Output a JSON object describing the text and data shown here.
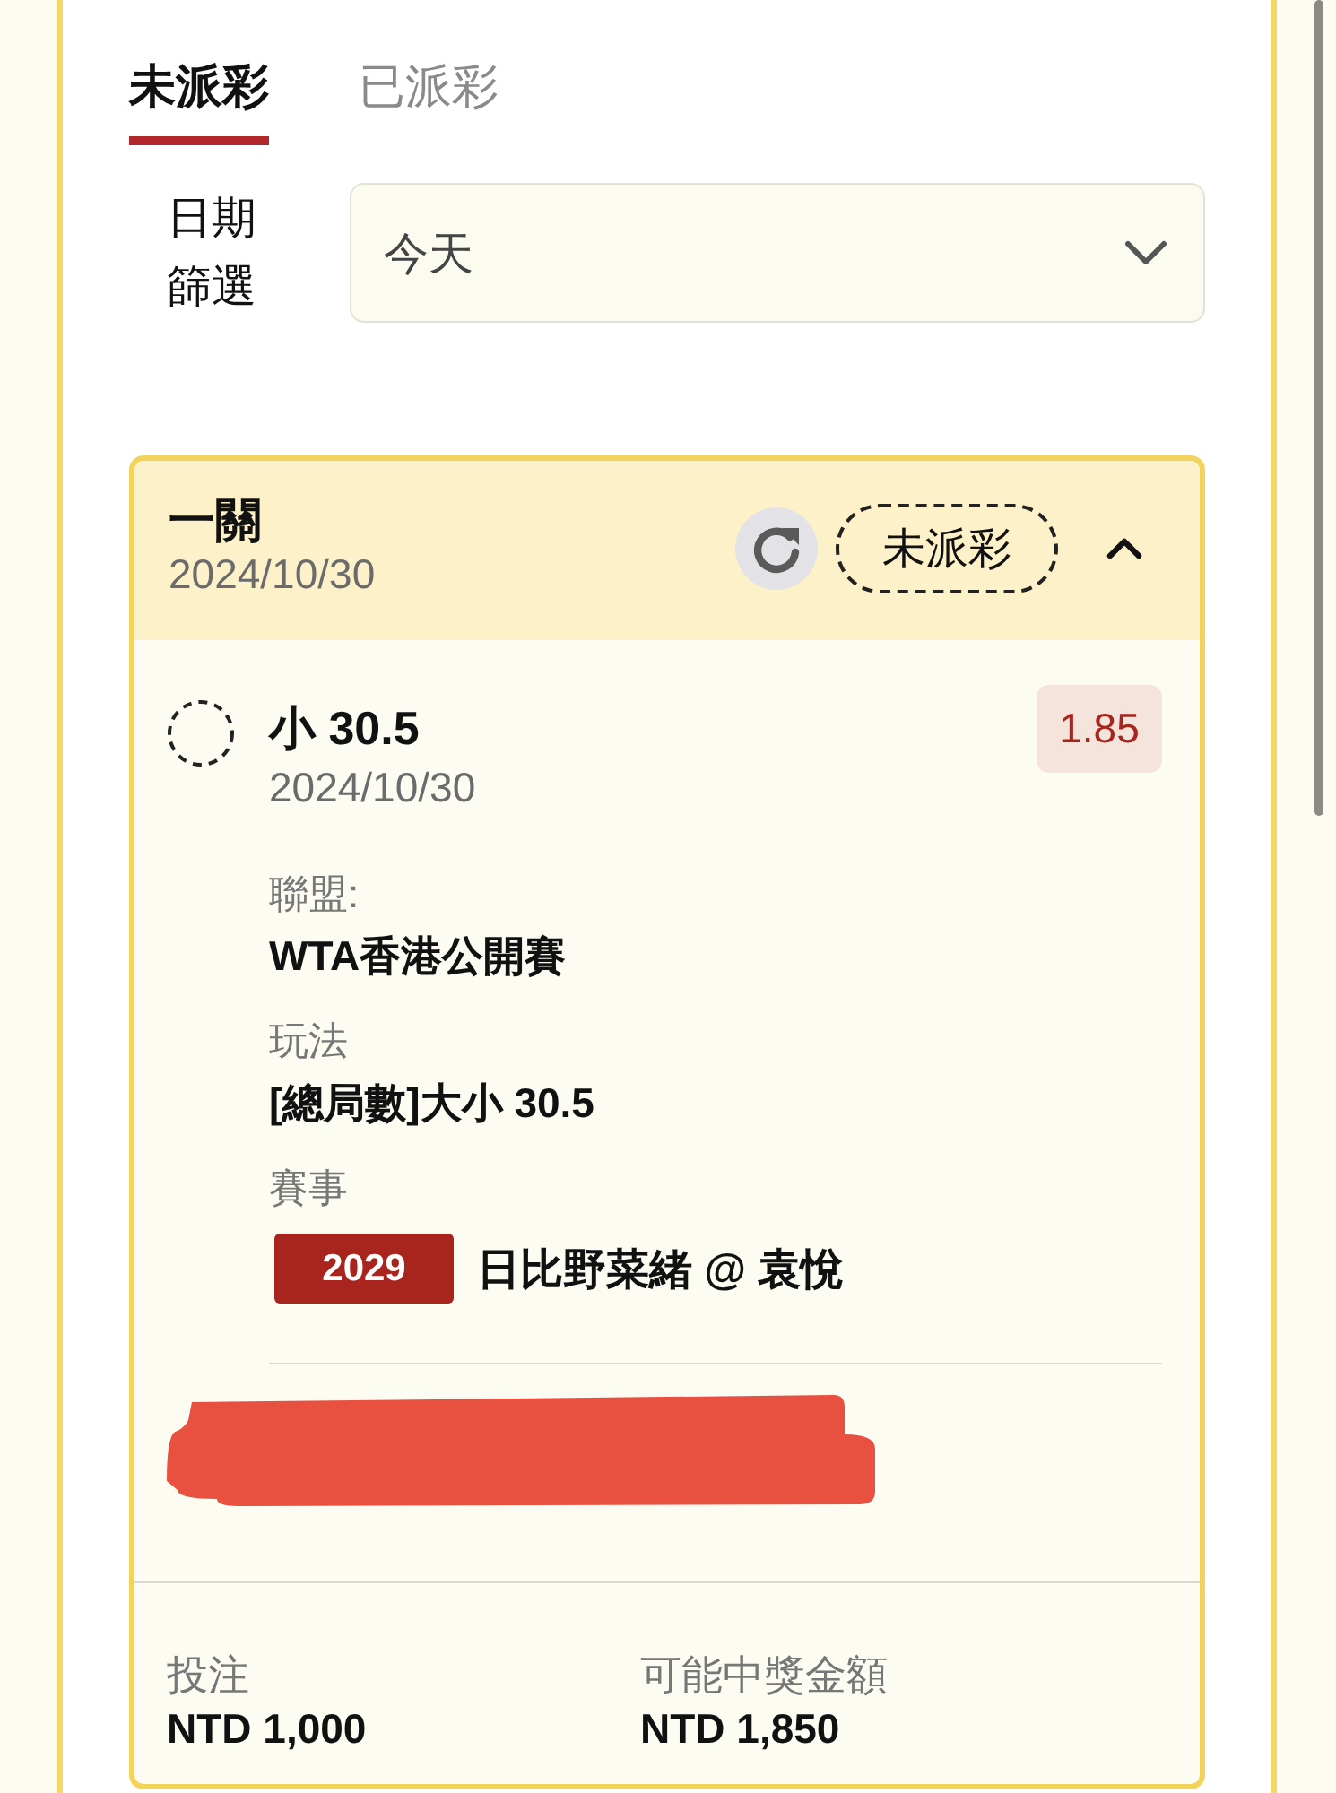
{
  "tabs": [
    {
      "label": "未派彩",
      "selected": true
    },
    {
      "label": "已派彩",
      "selected": false
    }
  ],
  "date_filter": {
    "label": "日期篩選",
    "value": "今天"
  },
  "bet_card": {
    "title": "一關",
    "date": "2024/10/30",
    "status": "未派彩",
    "expanded": true,
    "selection": {
      "name": "小 30.5",
      "date": "2024/10/30",
      "odds": "1.85",
      "details": [
        {
          "kind": "text",
          "label": "聯盟:",
          "value": "WTA香港公開賽"
        },
        {
          "kind": "text",
          "label": "玩法",
          "value": "[總局數]大小 30.5"
        },
        {
          "kind": "event",
          "label": "賽事",
          "code": "2029",
          "value": "日比野菜緒 @ 袁悅"
        }
      ]
    },
    "summary": [
      {
        "label": "投注",
        "value": "NTD 1,000"
      },
      {
        "label": "可能中獎金額",
        "value": "NTD 1,850"
      }
    ]
  }
}
